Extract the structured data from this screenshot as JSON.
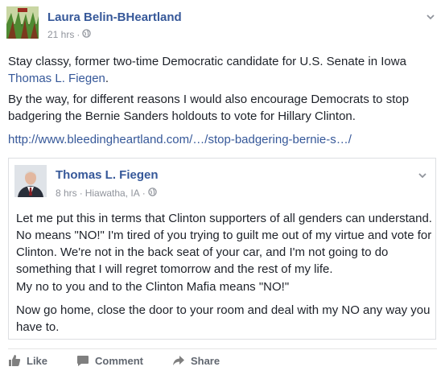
{
  "post": {
    "author": "Laura Belin-BHeartland",
    "time": "21 hrs",
    "dot": "·",
    "text_line1": "Stay classy, former two-time Democratic candidate for U.S. Senate in Iowa",
    "text_mention": "Thomas L. Fiegen",
    "text_mention_end": ".",
    "text_para2": "By the way, for different reasons I would also encourage Democrats to stop badgering the Bernie Sanders holdouts to vote for Hillary Clinton.",
    "link": "http://www.bleedingheartland.com/…/stop-badgering-bernie-s…/"
  },
  "shared": {
    "author": "Thomas L. Fiegen",
    "time": "8 hrs",
    "dot": "·",
    "location": "Hiawatha, IA",
    "dot2": "·",
    "para1": "Let me put this in terms that Clinton supporters of all genders can understand. No means \"NO!\" I'm tired of you trying to guilt me out of my virtue and vote for Clinton. We're not in the back seat of your car, and I'm not going to do something that I will regret tomorrow and the rest of my life.",
    "para2": "My no to you and to the Clinton Mafia means \"NO!\"",
    "para3": "Now go home, close the door to your room and deal with my NO any way you have to."
  },
  "actions": {
    "like": "Like",
    "comment": "Comment",
    "share": "Share"
  },
  "colors": {
    "link": "#365899",
    "meta": "#90949c",
    "text": "#1d2129",
    "action": "#616770"
  },
  "icons": [
    "globe-icon",
    "chevron-down-icon",
    "like-thumb-icon",
    "comment-icon",
    "share-icon"
  ]
}
